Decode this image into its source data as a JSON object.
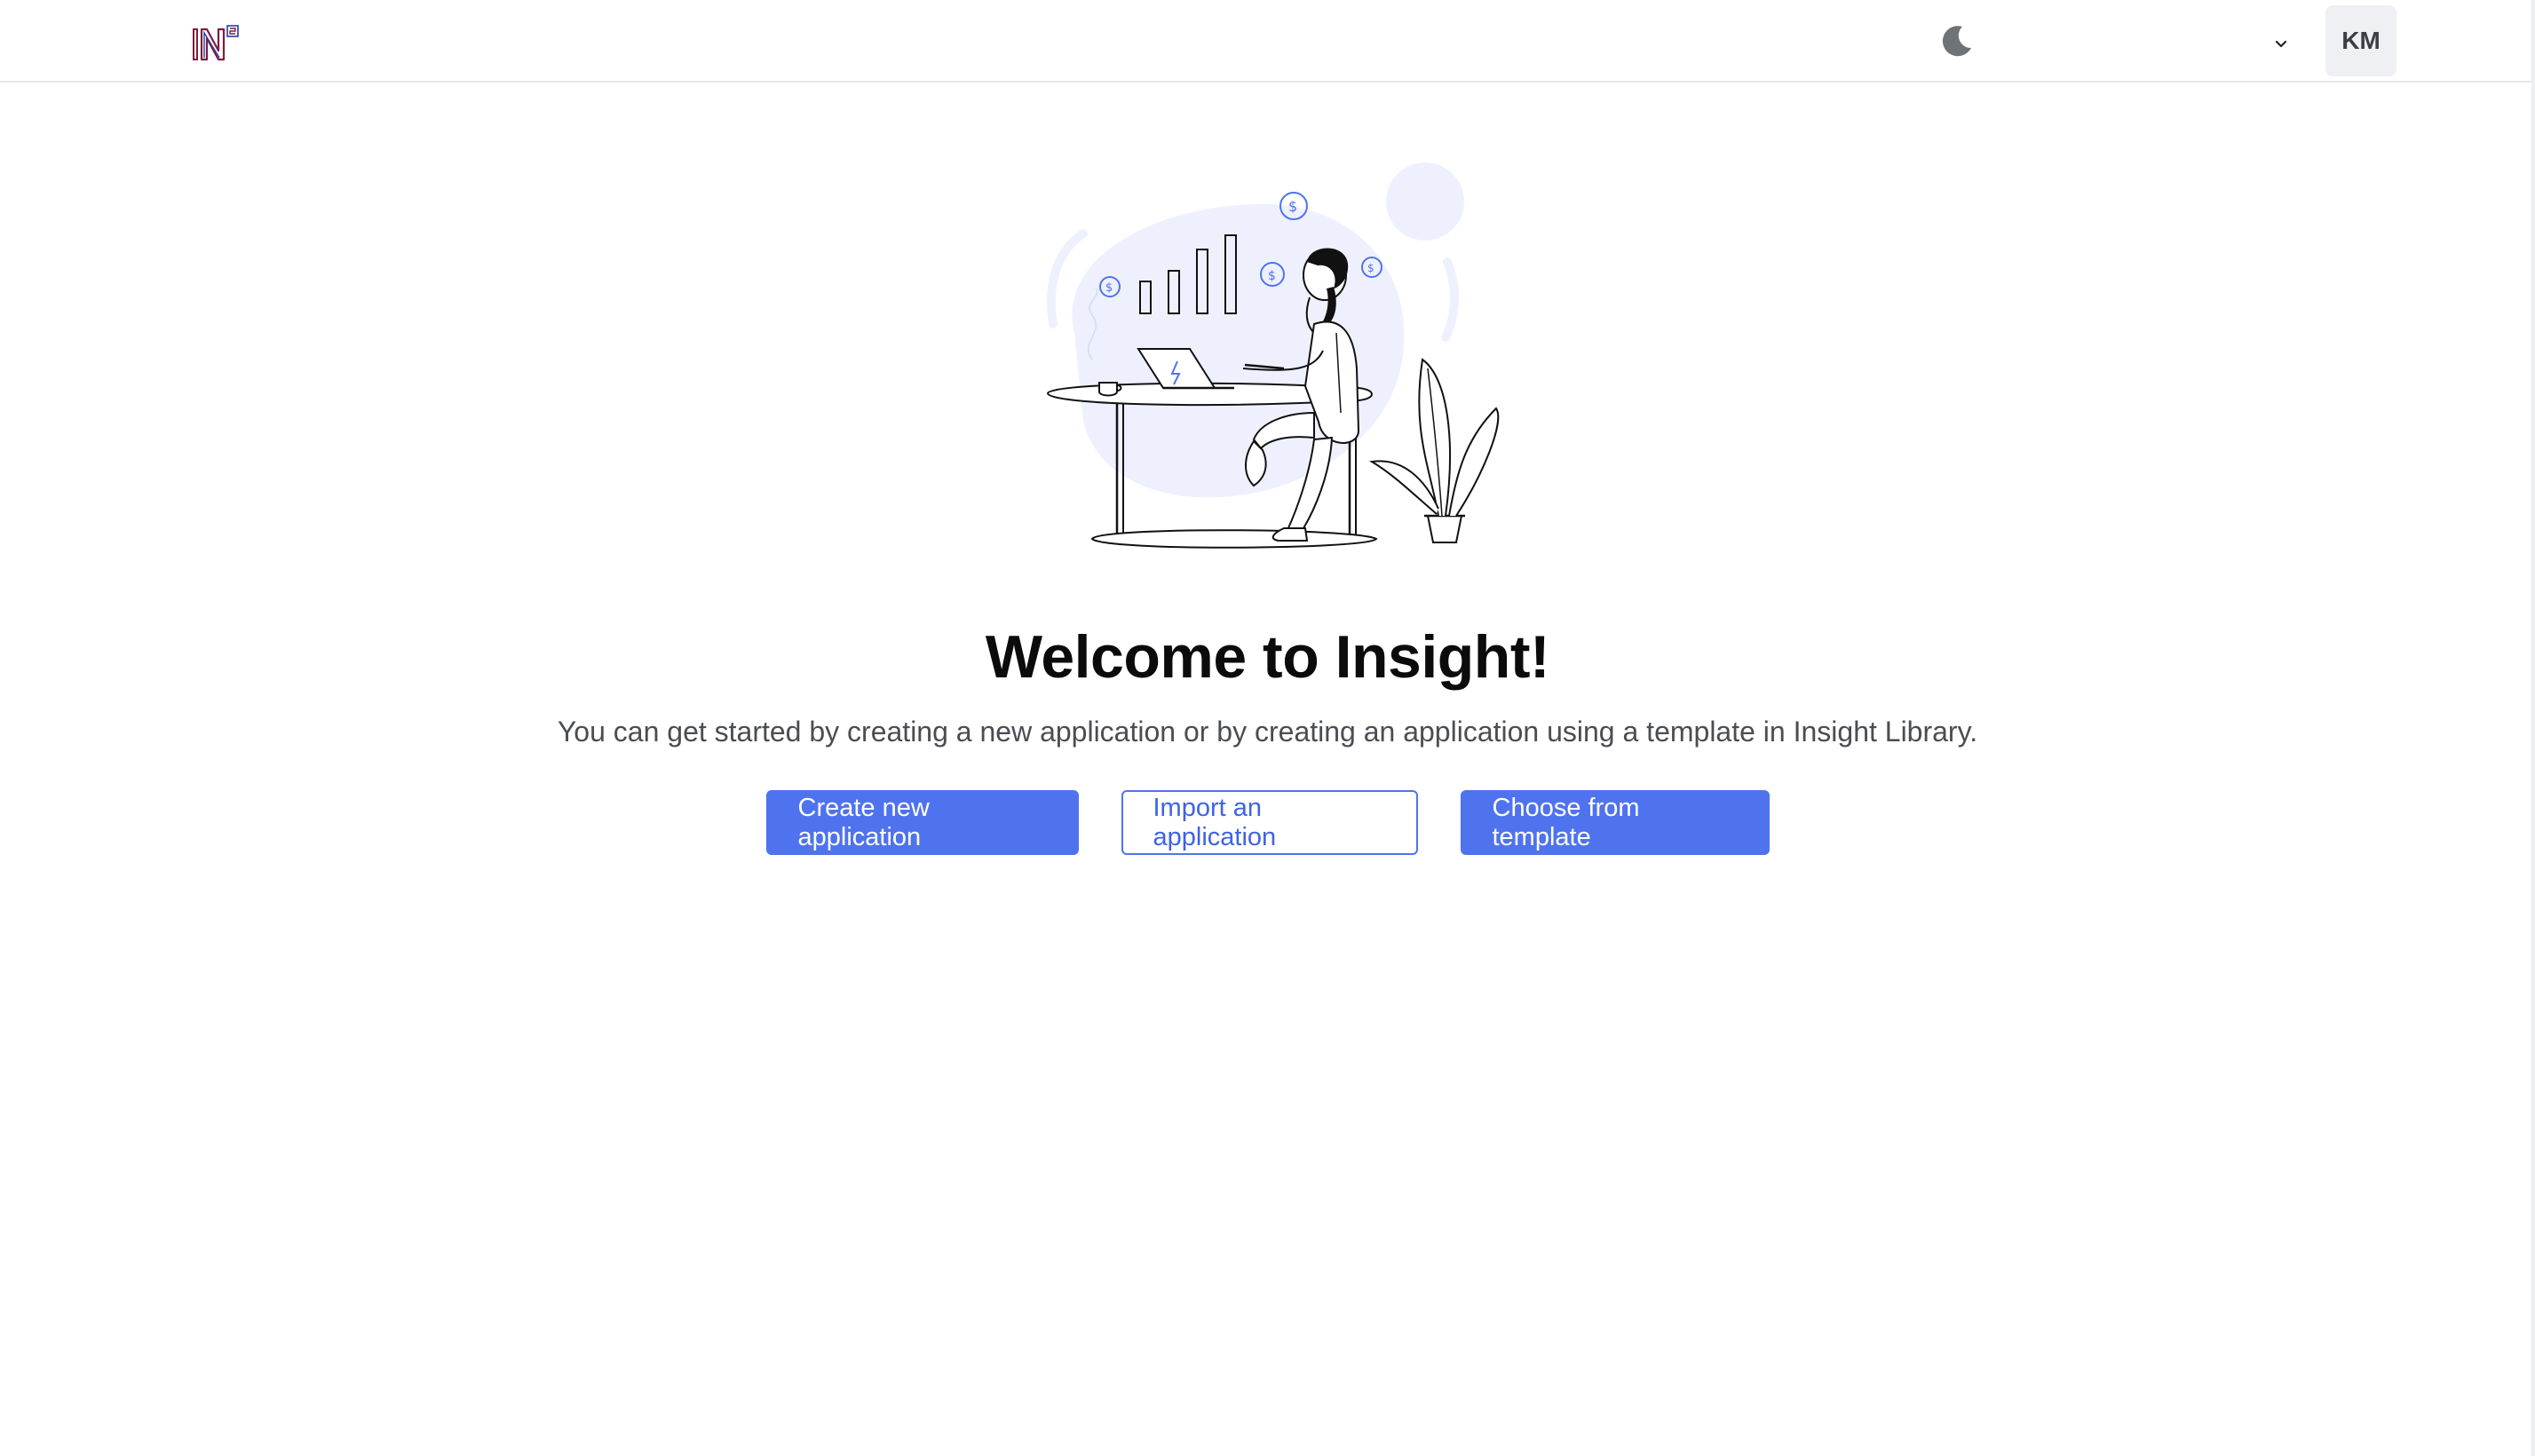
{
  "header": {
    "logo_icon": "insight-logo-icon",
    "theme_toggle_icon": "moon-icon",
    "workspace_selector": {
      "selected": "",
      "icon": "chevron-down-icon"
    },
    "avatar_initials": "KM"
  },
  "main": {
    "illustration": "person-at-desk-illustration",
    "title": "Welcome to Insight!",
    "subtitle": "You can get started by creating a new application or by creating an application using a template in Insight Library.",
    "buttons": {
      "create_label": "Create new application",
      "import_label": "Import an application",
      "template_label": "Choose from template"
    }
  },
  "colors": {
    "accent": "#4f73ee",
    "illustration_blob": "#eef1fd",
    "logo_primary": "#7a1f3d",
    "logo_secondary": "#2b3aa8"
  }
}
